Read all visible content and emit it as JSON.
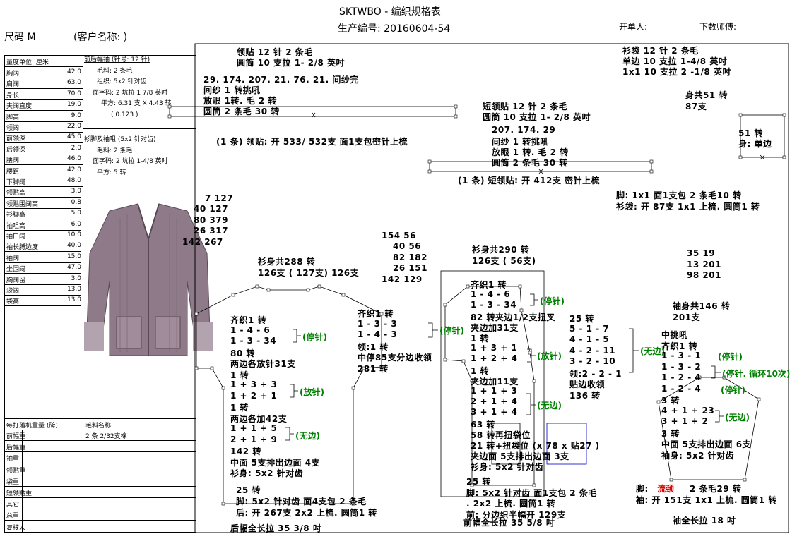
{
  "header": {
    "title": "SKTWBO - 编织规格表",
    "production_no": "生产编号: 20160604-54",
    "order_person": "开单人:",
    "master": "下数师傅:",
    "size": "尺码  M",
    "customer": "(客户名称:                )"
  },
  "measure_table": {
    "unit_label": "量度单位: 厘米",
    "rows": [
      {
        "label": "胸阔",
        "value": "42.0"
      },
      {
        "label": "肩阔",
        "value": "63.0"
      },
      {
        "label": "身长",
        "value": "70.0"
      },
      {
        "label": "夹阔直度",
        "value": "19.0"
      },
      {
        "label": "脚高",
        "value": "9.0"
      },
      {
        "label": "领阔",
        "value": "22.0"
      },
      {
        "label": "前领深",
        "value": "45.0"
      },
      {
        "label": "后领深",
        "value": "2.0"
      },
      {
        "label": "腰阔",
        "value": "46.0"
      },
      {
        "label": "腰距",
        "value": "42.0"
      },
      {
        "label": "下脚阔",
        "value": "48.0"
      },
      {
        "label": "领贴高",
        "value": "3.0"
      },
      {
        "label": "领贴围阔高",
        "value": "0.8"
      },
      {
        "label": "衫脚高",
        "value": "5.0"
      },
      {
        "label": "袖咀高",
        "value": "6.0"
      },
      {
        "label": "袖口阔",
        "value": "10.0"
      },
      {
        "label": "袖长膊边度",
        "value": "40.0"
      },
      {
        "label": "袖阔",
        "value": "15.0"
      },
      {
        "label": "坐围阔",
        "value": "47.0"
      },
      {
        "label": "胸阔留",
        "value": "3.0"
      },
      {
        "label": "袋阔",
        "value": "13.0"
      },
      {
        "label": "袋高",
        "value": "13.0"
      }
    ]
  },
  "notes_front": {
    "heading": "前后幅袖 (针号: 12 针)",
    "lines": [
      "毛料: 2 条毛",
      "组织: 5x2  针对齿",
      "面字码: 2 坑拉 1 7/8 英吋",
      "平方: 6.31 支 X  4.43 转",
      "( 0.123 )"
    ]
  },
  "notes_trim": {
    "heading": "衫脚及袖咀 (5x2  针对齿)",
    "lines": [
      "毛料: 2 条毛",
      "面字码: 2 坑拉 1-4/8 英吋",
      "平方: 5 转"
    ]
  },
  "weight_table": {
    "header_left": "每打落机重量 (磅)",
    "header_right": "毛料名称",
    "rows": [
      {
        "label": "前幅重",
        "value": "2 条 2/32支棉"
      },
      {
        "label": "后幅重",
        "value": ""
      },
      {
        "label": "袖重",
        "value": ""
      },
      {
        "label": "领贴重",
        "value": ""
      },
      {
        "label": "袋重",
        "value": ""
      },
      {
        "label": "短领贴重",
        "value": ""
      },
      {
        "label": "其它",
        "value": ""
      },
      {
        "label": "总重",
        "value": ""
      },
      {
        "label": "复核人",
        "value": ""
      }
    ]
  },
  "annotations": {
    "collar_top": [
      "领贴   12  针  2  条毛",
      "圆筒  10  支拉  1- 2/8  英吋"
    ],
    "collar_seq": [
      "29. 174. 207. 21. 76. 21.  间纱完",
      "间纱 1 转挑吼",
      "放眼 1转. 毛 2 转",
      "圆筒 2  条毛       30  转"
    ],
    "collar_note": "(1  条)  领贴:  开  533/  532支  面1支包密针上梳",
    "short_collar": [
      "短领贴   12  针  2  条毛",
      "圆筒  10  支拉  1- 2/8  英吋"
    ],
    "short_collar_seq": [
      "207. 174. 29",
      "间纱 1 转挑吼",
      "放眼 1 转. 毛 2 转",
      "圆筒 2  条毛       30  转"
    ],
    "short_collar_note": "(1  条)  短领贴:  开  412支  密针上梳",
    "pocket_top": [
      "衫袋    12  针  2  条毛",
      "单边  10  支拉  1-4/8  英吋",
      "1x1     10  支拉  2 -1/8  英吋"
    ],
    "pocket_body": [
      "身共51  转",
      "87支"
    ],
    "pocket_side": [
      "51  转",
      "身:  单边"
    ],
    "pocket_foot": [
      "脚:  1x1     面1支包  2  条毛10  转",
      "衫袋:  开  87支  1x1  上梳.  圆筒1  转"
    ],
    "left_nums": [
      "7     127",
      "40     127",
      "80     379",
      "26     317",
      "142     267"
    ],
    "back_total": [
      "衫身共288  转",
      "126支  (  127支)  126支"
    ],
    "back_body": [
      "齐织1  转",
      "1 - 4 - 6",
      "1 - 3 - 34",
      "80  转",
      "两边各放针31支",
      "1  转",
      "1 + 3 + 3",
      "1 + 2 + 1",
      "1  转",
      "两边各加42支",
      "1 + 1 + 5",
      "2 + 1 + 9",
      "142  转",
      "中面  5支排出边面  4支",
      "衫身:  5x2   针对齿"
    ],
    "back_tags": [
      "(停针)",
      "(放针)",
      "(无边)"
    ],
    "back_foot": [
      "25  转",
      "脚:  5x2   针对齿  面4支包  2  条毛",
      "后:  开  267支  2x2  上梳.  圆筒1  转"
    ],
    "back_length": "后幅全长拉  35  3/8  吋",
    "mid_nums": [
      "154     56",
      "40     56",
      "82     182",
      "26     151",
      "142     129"
    ],
    "neck_seq": [
      "齐织1  转",
      "1 - 3 - 3",
      "1 - 4 - 3",
      "领:1  转",
      "中停85支分边收领",
      "281  转"
    ],
    "neck_tag": "(停针)",
    "front_total": [
      "衫身共290  转",
      "126支  (  56支)"
    ],
    "front_body": [
      "齐织1  转",
      "1 - 4 - 6",
      "1 - 3 - 34",
      "82  转夹边1/2支扭叉",
      "夹边加31支",
      "1  转",
      "1 + 3 + 1",
      "1 + 2 + 4",
      "1  转",
      "夹边加11支",
      "1 + 1 + 3",
      "2 + 1 + 4",
      "3 + 1 + 4",
      "63  转",
      "58  转再扭袋位",
      "21  转+扭袋位 (x  78  x  贴27 )",
      "夹边面  5支排出边面  3支",
      "衫身:  5x2   针对齿"
    ],
    "front_tags": [
      "(停针)",
      "(放针)",
      "(无边)"
    ],
    "front_neck": [
      "25  转",
      "5 - 1 - 7",
      "4 - 1 - 5",
      "4 - 2 - 11",
      "3 - 2 - 10",
      "领:2 - 2 - 1",
      "贴边收领",
      "136  转"
    ],
    "front_neck_tag": "(无边)",
    "front_foot": [
      "25  转",
      "脚:  5x2   针对齿  面1支包  2  条毛",
      ".  2x2  上梳.  圆筒1  转",
      "前:  分边织半幅开  129支"
    ],
    "front_length": "前幅全长拉  35  5/8  吋",
    "sleeve_nums": [
      "35     19",
      "13     201",
      "98     201"
    ],
    "sleeve_total": [
      "袖身共146  转",
      "201支"
    ],
    "sleeve_body": [
      "中挑吼",
      "齐织1  转",
      "1 - 3 - 1",
      "1 - 3 - 2",
      "1 - 2 - 4",
      "1 - 2 - 4",
      "3  转",
      "4 + 1 + 23",
      "3 + 1 + 2",
      "3  转",
      "中面  5支排出边面  6支",
      "袖身:  5x2   针对齿"
    ],
    "sleeve_tags": [
      "(停针)",
      "(停针.  循环10次)",
      "(停针)",
      "(无边)"
    ],
    "sleeve_foot_prefix": "脚:",
    "sleeve_foot_red": "流颈",
    "sleeve_foot_rest": "2  条毛29  转",
    "sleeve_foot2": "袖:  开  151支  1x1  上梳.  圆筒1  转",
    "sleeve_length": "袖全长拉  18  吋"
  }
}
